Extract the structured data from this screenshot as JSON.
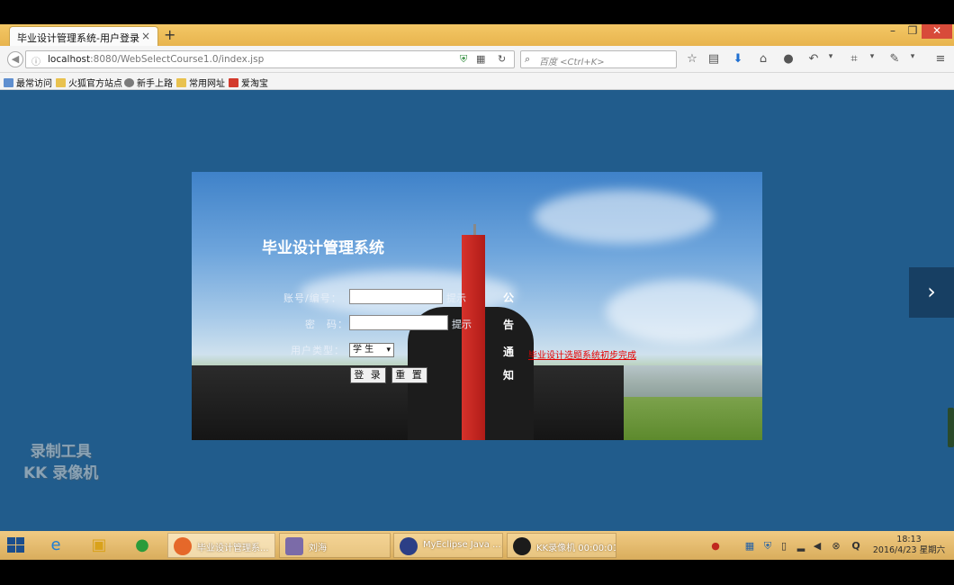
{
  "browser": {
    "tab_title": "毕业设计管理系统-用户登录",
    "tab_close": "×",
    "new_tab": "+",
    "window": {
      "minimize": "–",
      "restore": "❐",
      "close": "✕"
    },
    "url_host": "localhost",
    "url_rest": ":8080/WebSelectCourse1.0/index.jsp",
    "search_placeholder": "百度 <Ctrl+K>",
    "bookmarks": [
      "最常访问",
      "火狐官方站点",
      "新手上路",
      "常用网址",
      "爱淘宝"
    ]
  },
  "login": {
    "system_title": "毕业设计管理系统",
    "id_label": "账号/编号：",
    "password_label": "密　码：",
    "role_label": "用户类型：",
    "hint": "提示",
    "role_value": "学 生",
    "login_button": "登 录",
    "reset_button": "重 置",
    "notice_chars": [
      "公",
      "告",
      "通",
      "知"
    ],
    "notice_link": "毕业设计选题系统初步完成"
  },
  "watermark": {
    "line1": "录制工具",
    "line2": "KK 录像机"
  },
  "taskbar": {
    "tasks": [
      "毕业设计管理系...",
      "刘海",
      "MyEclipse Java ...",
      "KK录像机 00:00:01"
    ],
    "time": "18:13",
    "date": "2016/4/23 星期六"
  }
}
